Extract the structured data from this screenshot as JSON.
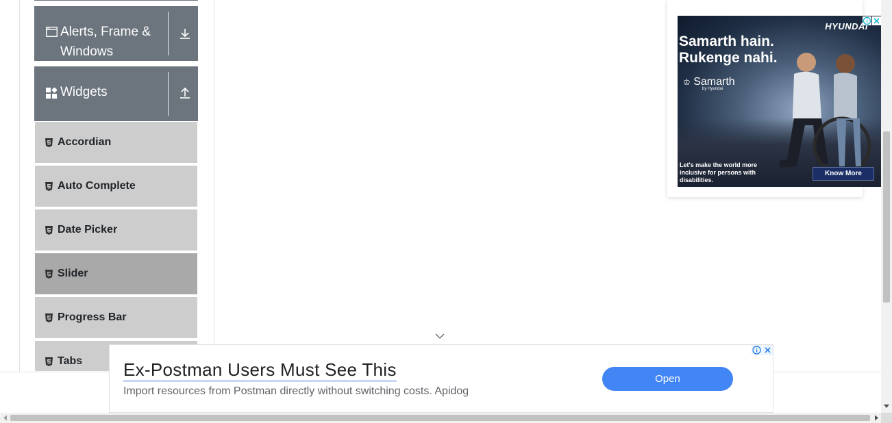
{
  "sidebar": {
    "groups": [
      {
        "label": "Alerts, Frame & Windows",
        "icon": "window-icon",
        "toggle_icon": "download-arrow-icon"
      },
      {
        "label": "Widgets",
        "icon": "widgets-icon",
        "toggle_icon": "upload-arrow-icon"
      }
    ],
    "items": [
      {
        "label": "Accordian",
        "icon": "html5-icon"
      },
      {
        "label": "Auto Complete",
        "icon": "html5-icon"
      },
      {
        "label": "Date Picker",
        "icon": "html5-icon"
      },
      {
        "label": "Slider",
        "icon": "html5-icon",
        "active": true
      },
      {
        "label": "Progress Bar",
        "icon": "html5-icon"
      },
      {
        "label": "Tabs",
        "icon": "html5-icon"
      }
    ]
  },
  "top_ad": {
    "brand": "HYUNDAI",
    "headline_line1": "Samarth hain.",
    "headline_line2": "Rukenge nahi.",
    "logo_text": "Samarth",
    "logo_sub": "by Hyundai",
    "footer_text": "Let's make the world more inclusive for persons with disabilities.",
    "cta": "Know More"
  },
  "bottom_ad": {
    "title": "Ex-Postman Users Must See This",
    "subtitle": "Import resources from Postman directly without switching costs. Apidog",
    "open_label": "Open"
  },
  "colors": {
    "group_header_bg": "#6c757d",
    "menu_item_bg": "#cdcdcd",
    "menu_item_active_bg": "#a9a9a9",
    "open_button_bg": "#4285f4"
  }
}
